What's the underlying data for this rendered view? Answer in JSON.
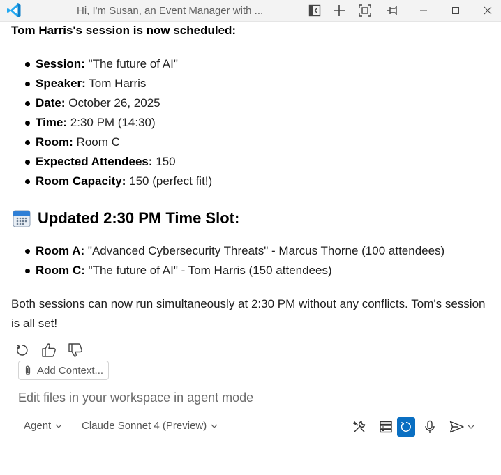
{
  "window": {
    "title": "Hi, I'm Susan, an Event Manager with ..."
  },
  "message": {
    "heading": "Tom Harris's session is now scheduled:",
    "details": [
      {
        "label": "Session:",
        "value": " \"The future of AI\""
      },
      {
        "label": "Speaker:",
        "value": " Tom Harris"
      },
      {
        "label": "Date:",
        "value": " October 26, 2025"
      },
      {
        "label": "Time:",
        "value": " 2:30 PM (14:30)"
      },
      {
        "label": "Room:",
        "value": " Room C"
      },
      {
        "label": "Expected Attendees:",
        "value": " 150"
      },
      {
        "label": "Room Capacity:",
        "value": " 150 (perfect fit!)"
      }
    ],
    "slot_heading": "Updated 2:30 PM Time Slot:",
    "slot_items": [
      {
        "label": "Room A:",
        "value": " \"Advanced Cybersecurity Threats\" - Marcus Thorne (100 attendees)"
      },
      {
        "label": "Room C:",
        "value": " \"The future of AI\" - Tom Harris (150 attendees)"
      }
    ],
    "summary": "Both sessions can now run simultaneously at 2:30 PM without any conflicts. Tom's session is all set!"
  },
  "input": {
    "add_context_label": "Add Context...",
    "placeholder": "Edit files in your workspace in agent mode",
    "mode_label": "Agent",
    "model_label": "Claude Sonnet 4 (Preview)"
  },
  "icons": {
    "titlebar": [
      "vscode-logo",
      "toggle-sidebar-icon",
      "plus-icon",
      "maximize-editor-icon",
      "pin-icon",
      "minimize-icon",
      "restore-icon",
      "close-icon"
    ],
    "feedback": [
      "retry-icon",
      "thumbs-up-icon",
      "thumbs-down-icon"
    ],
    "toolbar": [
      "tools-icon",
      "server-icon",
      "refresh-icon",
      "microphone-icon",
      "send-icon"
    ]
  },
  "colors": {
    "accent": "#0a6fc2",
    "vscode_blue": "#23a9f2"
  }
}
